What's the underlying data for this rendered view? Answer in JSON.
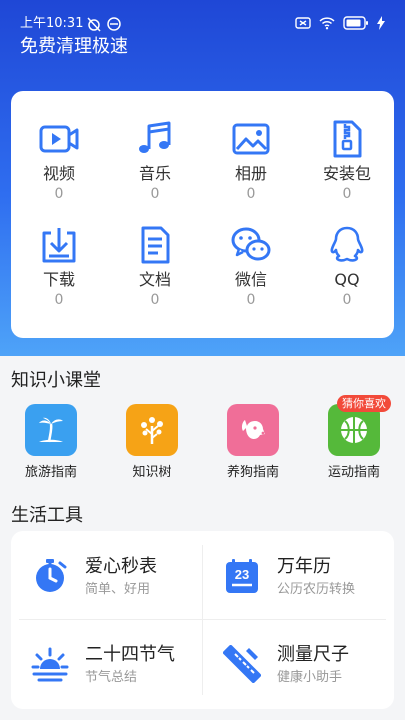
{
  "status": {
    "time": "上午10:31"
  },
  "app": {
    "title": "免费清理极速"
  },
  "categories": [
    {
      "label": "视频",
      "count": "0",
      "icon": "video-icon"
    },
    {
      "label": "音乐",
      "count": "0",
      "icon": "music-icon"
    },
    {
      "label": "相册",
      "count": "0",
      "icon": "image-icon"
    },
    {
      "label": "安装包",
      "count": "0",
      "icon": "zip-icon"
    },
    {
      "label": "下载",
      "count": "0",
      "icon": "download-icon"
    },
    {
      "label": "文档",
      "count": "0",
      "icon": "document-icon"
    },
    {
      "label": "微信",
      "count": "0",
      "icon": "wechat-icon"
    },
    {
      "label": "QQ",
      "count": "0",
      "icon": "qq-icon"
    }
  ],
  "knowledge": {
    "title": "知识小课堂",
    "items": [
      {
        "label": "旅游指南",
        "icon": "palm-tree-icon",
        "color": "#3aa0f0"
      },
      {
        "label": "知识树",
        "icon": "tree-icon",
        "color": "#f6a316"
      },
      {
        "label": "养狗指南",
        "icon": "dog-icon",
        "color": "#f06e98"
      },
      {
        "label": "运动指南",
        "icon": "basketball-icon",
        "color": "#55b93a",
        "badge": "猜你喜欢"
      }
    ]
  },
  "tools": {
    "title": "生活工具",
    "items": [
      {
        "title": "爱心秒表",
        "subtitle": "简单、好用",
        "icon": "stopwatch-icon"
      },
      {
        "title": "万年历",
        "subtitle": "公历农历转换",
        "icon": "calendar-icon",
        "icon_text": "23"
      },
      {
        "title": "二十四节气",
        "subtitle": "节气总结",
        "icon": "sunrise-icon"
      },
      {
        "title": "测量尺子",
        "subtitle": "健康小助手",
        "icon": "ruler-icon"
      }
    ]
  },
  "colors": {
    "accent": "#2f6ef0",
    "icon_blue": "#3477f5"
  }
}
